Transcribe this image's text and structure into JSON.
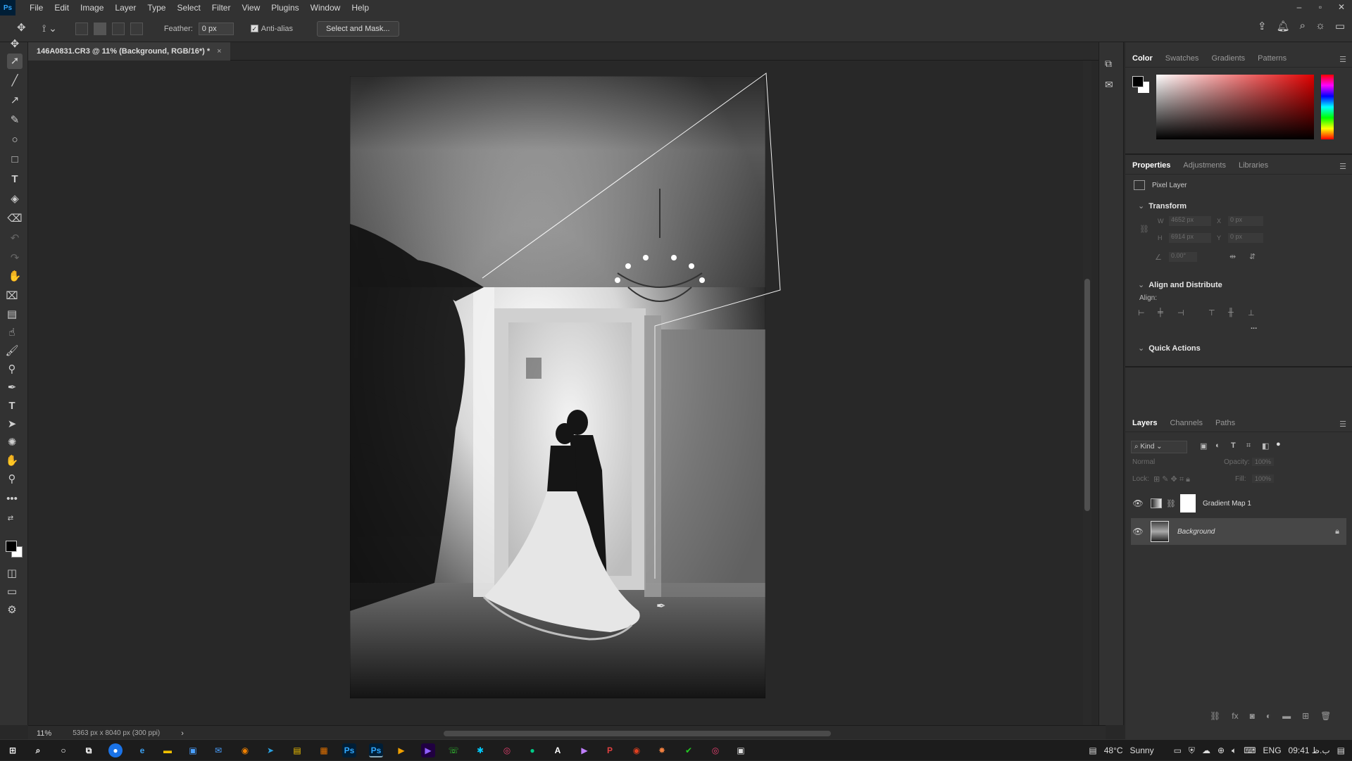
{
  "app": {
    "logo": "Ps",
    "menu": [
      "File",
      "Edit",
      "Image",
      "Layer",
      "Type",
      "Select",
      "Filter",
      "View",
      "Plugins",
      "Window",
      "Help"
    ],
    "window_controls": [
      "–",
      "▫",
      "✕"
    ]
  },
  "options_bar": {
    "feather_label": "Feather:",
    "feather_value": "0 px",
    "antialias_label": "Anti-alias",
    "select_mask_label": "Select and Mask..."
  },
  "document": {
    "tab_title": "146A0831.CR3 @ 11% (Background, RGB/16*) *",
    "tab_close": "×"
  },
  "status": {
    "zoom": "11%",
    "dimensions": "5363 px x 8040 px (300 ppi)",
    "arrow": "›"
  },
  "color_panel": {
    "tabs": [
      "Color",
      "Swatches",
      "Gradients",
      "Patterns"
    ],
    "active_tab": "Color",
    "hue_color": "#e00000"
  },
  "properties_panel": {
    "tabs": [
      "Properties",
      "Adjustments",
      "Libraries"
    ],
    "active_tab": "Properties",
    "layer_type": "Pixel Layer",
    "transform_title": "Transform",
    "w_label": "W",
    "w_value": "4652 px",
    "h_label": "H",
    "h_value": "6914 px",
    "x_label": "X",
    "x_value": "0 px",
    "y_label": "Y",
    "y_value": "0 px",
    "angle_value": "0.00°",
    "align_title": "Align and Distribute",
    "align_label": "Align:",
    "more": "...",
    "quick_actions_title": "Quick Actions"
  },
  "layers_panel": {
    "tabs": [
      "Layers",
      "Channels",
      "Paths"
    ],
    "active_tab": "Layers",
    "filter_kind": "Kind",
    "blend_mode": "Normal",
    "opacity_label": "Opacity:",
    "opacity_value": "100%",
    "lock_label": "Lock:",
    "fill_label": "Fill:",
    "fill_value": "100%",
    "layers": [
      {
        "name": "Gradient Map 1",
        "visible": true
      },
      {
        "name": "Background",
        "visible": true,
        "locked": true
      }
    ]
  },
  "taskbar": {
    "weather_temp": "48°C",
    "weather_text": "Sunny",
    "language": "ENG",
    "time": "09:41 ب.ظ"
  }
}
